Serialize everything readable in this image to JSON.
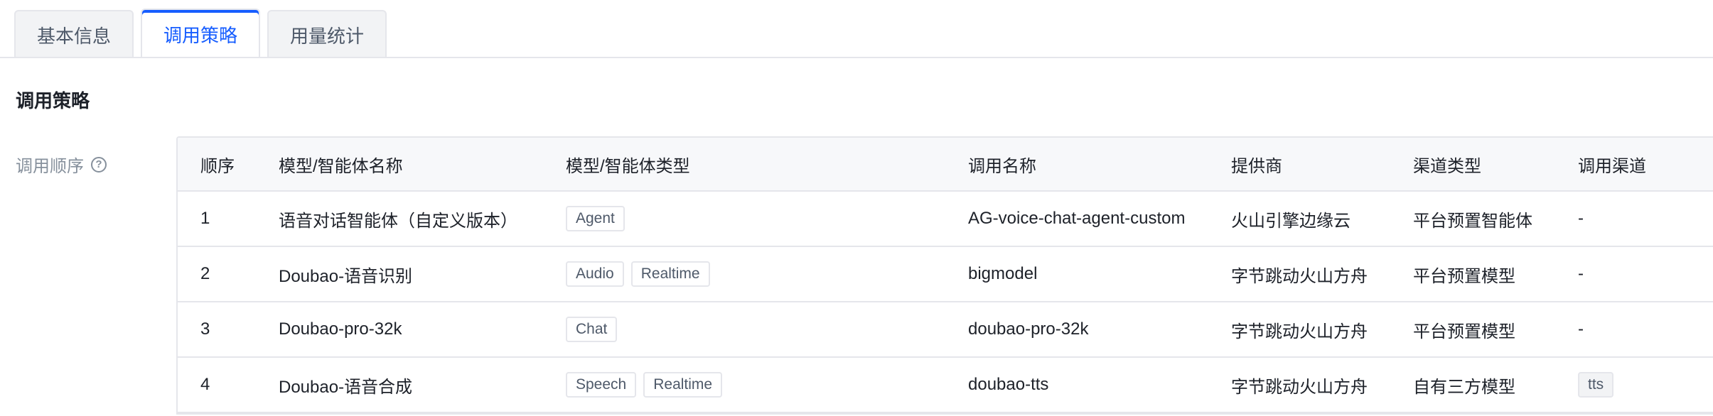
{
  "tabs": [
    {
      "label": "基本信息",
      "active": false
    },
    {
      "label": "调用策略",
      "active": true
    },
    {
      "label": "用量统计",
      "active": false
    }
  ],
  "section": {
    "title": "调用策略",
    "field_label": "调用顺序",
    "help_icon": "question-circle-icon"
  },
  "table": {
    "headers": [
      "顺序",
      "模型/智能体名称",
      "模型/智能体类型",
      "调用名称",
      "提供商",
      "渠道类型",
      "调用渠道"
    ],
    "rows": [
      {
        "order": "1",
        "name": "语音对话智能体（自定义版本）",
        "types": [
          "Agent"
        ],
        "call_name": "AG-voice-chat-agent-custom",
        "provider": "火山引擎边缘云",
        "channel_type": "平台预置智能体",
        "channel": "-"
      },
      {
        "order": "2",
        "name": "Doubao-语音识别",
        "types": [
          "Audio",
          "Realtime"
        ],
        "call_name": "bigmodel",
        "provider": "字节跳动火山方舟",
        "channel_type": "平台预置模型",
        "channel": "-"
      },
      {
        "order": "3",
        "name": "Doubao-pro-32k",
        "types": [
          "Chat"
        ],
        "call_name": "doubao-pro-32k",
        "provider": "字节跳动火山方舟",
        "channel_type": "平台预置模型",
        "channel": "-"
      },
      {
        "order": "4",
        "name": "Doubao-语音合成",
        "types": [
          "Speech",
          "Realtime"
        ],
        "call_name": "doubao-tts",
        "provider": "字节跳动火山方舟",
        "channel_type": "自有三方模型",
        "channel": "tts",
        "channel_is_tag": true
      }
    ]
  },
  "colors": {
    "accent": "#165dff",
    "border": "#e5e6eb",
    "header_bg": "#f7f8fa",
    "muted": "#86909c"
  }
}
